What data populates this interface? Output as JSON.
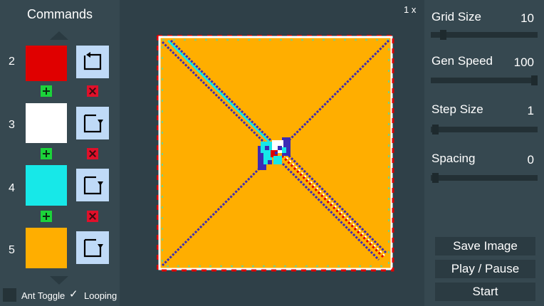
{
  "commands": {
    "title": "Commands",
    "items": [
      {
        "number": "2",
        "color": "#e00000",
        "turn": "turn-left"
      },
      {
        "number": "3",
        "color": "#ffffff",
        "turn": "turn-right"
      },
      {
        "number": "4",
        "color": "#17e8e8",
        "turn": "turn-right"
      },
      {
        "number": "5",
        "color": "#ffae00",
        "turn": "turn-right"
      }
    ]
  },
  "options": {
    "ant_toggle_label": "Ant Toggle",
    "looping_label": "Looping",
    "looping_checked": true
  },
  "zoom": "1 x",
  "settings": {
    "grid_size": {
      "label": "Grid Size",
      "value": "10",
      "fraction": 0.08
    },
    "gen_speed": {
      "label": "Gen Speed",
      "value": "100",
      "fraction": 1.0
    },
    "step_size": {
      "label": "Step Size",
      "value": "1",
      "fraction": 0.0
    },
    "spacing": {
      "label": "Spacing",
      "value": "0",
      "fraction": 0.0
    }
  },
  "actions": {
    "save_image": "Save Image",
    "play_pause": "Play / Pause",
    "start": "Start"
  },
  "colors": {
    "background": "#2f4048",
    "panel": "#364850",
    "fill": "#ffae00",
    "diagonal": "#3b2bb5",
    "border_red": "#e00000",
    "border_white": "#ffffff",
    "cyan": "#17e8e8"
  }
}
